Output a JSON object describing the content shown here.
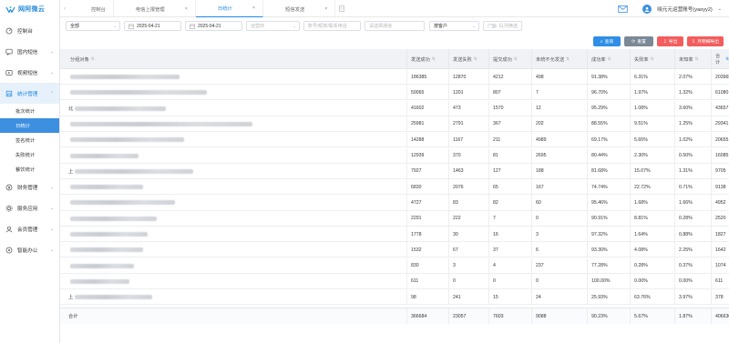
{
  "brand": {
    "logo_text": "网阿微云"
  },
  "sidebar": {
    "items": [
      {
        "label": "控制台",
        "icon": "dashboard-icon",
        "active": false,
        "chevron": false
      },
      {
        "label": "国内短信",
        "icon": "message-icon",
        "active": false,
        "chevron": true
      },
      {
        "label": "视频短信",
        "icon": "video-icon",
        "active": false,
        "chevron": true
      },
      {
        "label": "统计管理",
        "icon": "statistics-icon",
        "active": true,
        "chevron": true
      }
    ],
    "subitems": [
      {
        "label": "批次统计",
        "active": false
      },
      {
        "label": "日统计",
        "active": true
      },
      {
        "label": "签名统计",
        "active": false
      },
      {
        "label": "失败统计",
        "active": false
      },
      {
        "label": "餐饮统计",
        "active": false
      }
    ],
    "items_after": [
      {
        "label": "财务管理",
        "icon": "finance-icon"
      },
      {
        "label": "服务应用",
        "icon": "service-icon"
      },
      {
        "label": "会员管理",
        "icon": "member-icon"
      },
      {
        "label": "智能办公",
        "icon": "office-icon"
      }
    ]
  },
  "topbar": {
    "tabs": [
      {
        "label": "控制台",
        "active": false,
        "closable": false
      },
      {
        "label": "电信上报管理",
        "active": false,
        "closable": true
      },
      {
        "label": "日统计",
        "active": true,
        "closable": true
      },
      {
        "label": "短信发送",
        "active": false,
        "closable": true
      }
    ],
    "close_glyph": "×",
    "user": "晓元元运营账号(yaoyy2)"
  },
  "filters": {
    "scope": "全部",
    "date_start": "2025-04-21",
    "date_end": "2025-04-21",
    "carrier_placeholder": "运营商",
    "account_placeholder": "账号/昵称/联系电话",
    "channel_placeholder": "请选择通道",
    "group_by": "按客户",
    "toggle_label": "队列筛选"
  },
  "actions": {
    "search": "查询",
    "reset": "重置",
    "export": "导出",
    "export_detail": "月明细导出",
    "colors": {
      "search": "#2f8fe6",
      "reset": "#7b8896",
      "export": "#f25d5d",
      "export_detail": "#f25d5d"
    }
  },
  "table": {
    "headers": [
      "分组对象",
      "发送成功",
      "发送失败",
      "提交成功",
      "未统不允发送",
      "成功率",
      "失败率",
      "未知率",
      "合计"
    ],
    "rows": [
      {
        "lead": "",
        "blur": 120,
        "v": [
          "186385",
          "12870",
          "4212",
          "498",
          "91.38%",
          "6.31%",
          "2.07%",
          "203965"
        ]
      },
      {
        "lead": "",
        "blur": 150,
        "v": [
          "59065",
          "1201",
          "807",
          "7",
          "96.70%",
          "1.97%",
          "1.32%",
          "61080"
        ]
      },
      {
        "lead": "北",
        "blur": 100,
        "v": [
          "41602",
          "473",
          "1570",
          "12",
          "95.29%",
          "1.08%",
          "3.60%",
          "43657"
        ]
      },
      {
        "lead": "",
        "blur": 200,
        "v": [
          "25981",
          "2791",
          "367",
          "202",
          "88.55%",
          "9.51%",
          "1.25%",
          "29341"
        ]
      },
      {
        "lead": "",
        "blur": 125,
        "v": [
          "14288",
          "1167",
          "211",
          "4989",
          "69.17%",
          "5.65%",
          "1.02%",
          "20655"
        ]
      },
      {
        "lead": "",
        "blur": 75,
        "v": [
          "12939",
          "370",
          "81",
          "2695",
          "80.44%",
          "2.30%",
          "0.50%",
          "16085"
        ]
      },
      {
        "lead": "上",
        "blur": 130,
        "v": [
          "7927",
          "1463",
          "127",
          "188",
          "81.68%",
          "15.07%",
          "1.31%",
          "9705"
        ]
      },
      {
        "lead": "",
        "blur": 80,
        "v": [
          "6830",
          "2076",
          "65",
          "167",
          "74.74%",
          "22.72%",
          "0.71%",
          "9138"
        ]
      },
      {
        "lead": "",
        "blur": 115,
        "v": [
          "4727",
          "83",
          "82",
          "60",
          "95.46%",
          "1.68%",
          "1.66%",
          "4952"
        ]
      },
      {
        "lead": "",
        "blur": 95,
        "v": [
          "2291",
          "222",
          "7",
          "0",
          "90.91%",
          "8.81%",
          "0.28%",
          "2520"
        ]
      },
      {
        "lead": "",
        "blur": 85,
        "v": [
          "1778",
          "30",
          "16",
          "3",
          "97.32%",
          "1.64%",
          "0.88%",
          "1827"
        ]
      },
      {
        "lead": "",
        "blur": 80,
        "v": [
          "1532",
          "67",
          "37",
          "6",
          "93.30%",
          "4.08%",
          "2.25%",
          "1642"
        ]
      },
      {
        "lead": "",
        "blur": 70,
        "v": [
          "830",
          "3",
          "4",
          "237",
          "77.28%",
          "0.28%",
          "0.37%",
          "1074"
        ]
      },
      {
        "lead": "",
        "blur": 65,
        "v": [
          "611",
          "0",
          "0",
          "0",
          "100.00%",
          "0.00%",
          "0.00%",
          "611"
        ]
      },
      {
        "lead": "上",
        "blur": 85,
        "v": [
          "98",
          "241",
          "15",
          "24",
          "25.93%",
          "63.76%",
          "3.97%",
          "378"
        ]
      }
    ],
    "total": {
      "label": "合计",
      "v": [
        "366684",
        "23057",
        "7603",
        "9088",
        "90.23%",
        "5.67%",
        "1.87%",
        "406630"
      ]
    }
  }
}
